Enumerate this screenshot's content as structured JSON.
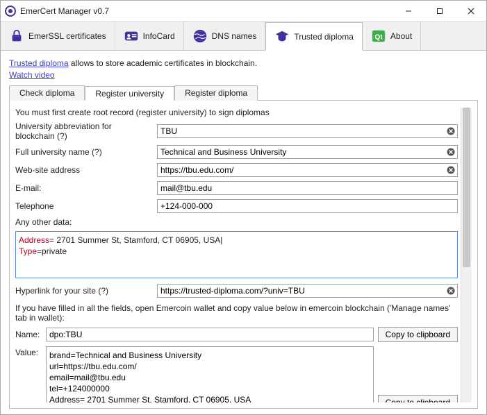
{
  "app": {
    "title": "EmerCert Manager v0.7"
  },
  "win": {
    "min": "–",
    "max": "□",
    "close": "×"
  },
  "maintabs": {
    "emerssl": "EmerSSL certificates",
    "infocard": "InfoCard",
    "dns": "DNS names",
    "diploma": "Trusted diploma",
    "about": "About"
  },
  "intro": {
    "link1": "Trusted diploma",
    "rest1": " allows to store academic certificates in blockchain.",
    "link2": "Watch video"
  },
  "subtabs": {
    "check": "Check diploma",
    "register_u": "Register university",
    "register_d": "Register diploma"
  },
  "form": {
    "hint": "You must first create root record (register university) to sign diplomas",
    "abbrev_label": "University abbreviation for blockchain (?)",
    "abbrev_value": "TBU",
    "fullname_label": "Full university name (?)",
    "fullname_value": "Technical and Business University",
    "website_label": "Web-site address",
    "website_value": "https://tbu.edu.com/",
    "email_label": "E-mail:",
    "email_value": "mail@tbu.edu",
    "tel_label": "Telephone",
    "tel_value": "+124-000-000",
    "other_label": "Any other data:",
    "other_key1": "Address",
    "other_rest1": "= 2701 Summer St, Stamford, CT 06905, USA|",
    "other_key2": "Type",
    "other_rest2": "=private",
    "hyperlink_label": "Hyperlink for your site (?)",
    "hyperlink_value": "https://trusted-diploma.com/?univ=TBU",
    "instructions": "If you have filled in all the fields, open Emercoin wallet and copy value below in emercoin blockchain ('Manage names' tab in wallet):",
    "name_label": "Name:",
    "name_value": "dpo:TBU",
    "value_label": "Value:",
    "value_text": "brand=Technical and Business University\nurl=https://tbu.edu.com/\nemail=mail@tbu.edu\ntel=+124000000\nAddress= 2701 Summer St, Stamford, CT 06905, USA\nType=private",
    "copy_btn": "Copy to clipboard"
  }
}
